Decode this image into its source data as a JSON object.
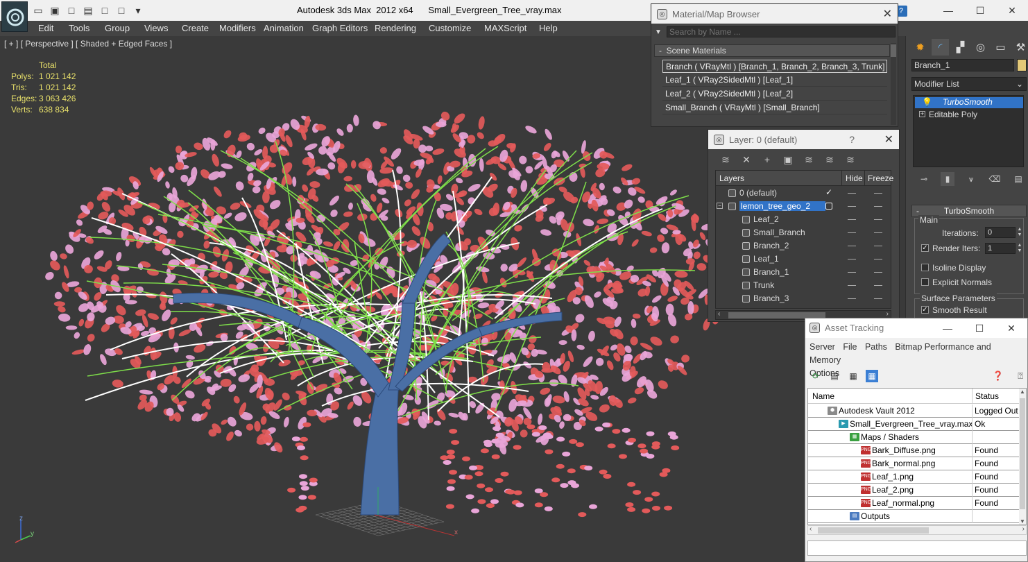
{
  "titlebar": {
    "title": "Autodesk 3ds Max  2012 x64      Small_Evergreen_Tree_vray.max",
    "logo_icon": "app-logo-icon",
    "quick_access_icons": [
      "open-icon",
      "save-icon",
      "new-icon",
      "hold-icon",
      "window-icon",
      "undo-icon",
      "dropdown-icon"
    ],
    "help_label": "?",
    "minimize": "—",
    "maximize": "☐",
    "close": "✕"
  },
  "menu": {
    "items": [
      "Edit",
      "Tools",
      "Group",
      "Views",
      "Create",
      "Modifiers",
      "Animation",
      "Graph Editors",
      "Rendering",
      "Customize",
      "MAXScript",
      "Help"
    ]
  },
  "viewport": {
    "label": "[ + ] [ Perspective ] [ Shaded + Edged Faces ]",
    "stats": {
      "total_label": "Total",
      "rows": [
        {
          "label": "Polys:",
          "value": "1 021 142"
        },
        {
          "label": "Tris:",
          "value": "1 021 142"
        },
        {
          "label": "Edges:",
          "value": "3 063 426"
        },
        {
          "label": "Verts:",
          "value": "638 834"
        }
      ]
    },
    "axis_labels": {
      "z": "z",
      "y": "y",
      "x": "x"
    },
    "colors": {
      "leaf_red": "#e35a5a",
      "leaf_pink": "#e9a5d8",
      "branch_white": "#ffffff",
      "twig_green": "#7fe04a",
      "trunk_blue": "#4a6fa5"
    }
  },
  "material_browser": {
    "title": "Material/Map Browser",
    "search_placeholder": "Search by Name ...",
    "section": "Scene Materials",
    "section_toggle": "-",
    "materials": [
      "Branch  ( VRayMtl )  [Branch_1, Branch_2, Branch_3, Trunk]",
      "Leaf_1  ( VRay2SidedMtl )  [Leaf_1]",
      "Leaf_2  ( VRay2SidedMtl )  [Leaf_2]",
      "Small_Branch  ( VRayMtl )  [Small_Branch]"
    ]
  },
  "layer_dialog": {
    "title": "Layer: 0 (default)",
    "help": "?",
    "columns": {
      "layers": "Layers",
      "hide": "Hide",
      "freeze": "Freeze"
    },
    "rows": [
      {
        "name": "0 (default)",
        "indent": 0
      },
      {
        "name": "lemon_tree_geo_2",
        "indent": 0
      },
      {
        "name": "Leaf_2",
        "indent": 1
      },
      {
        "name": "Small_Branch",
        "indent": 1
      },
      {
        "name": "Branch_2",
        "indent": 1
      },
      {
        "name": "Leaf_1",
        "indent": 1
      },
      {
        "name": "Branch_1",
        "indent": 1
      },
      {
        "name": "Trunk",
        "indent": 1
      },
      {
        "name": "Branch_3",
        "indent": 1
      }
    ]
  },
  "command_panel": {
    "object_name": "Branch_1",
    "object_color": "#e3c878",
    "modifier_list": "Modifier List",
    "stack": [
      "TurboSmooth",
      "Editable Poly"
    ],
    "rollout_title": "TurboSmooth",
    "main_group": "Main",
    "iterations_label": "Iterations:",
    "iterations_value": "0",
    "render_iters_label": "Render Iters:",
    "render_iters_value": "1",
    "isoline_label": "Isoline Display",
    "explicit_normals_label": "Explicit Normals",
    "surface_group": "Surface Parameters",
    "smooth_result_label": "Smooth Result",
    "rollout_toggle": "-"
  },
  "asset_tracking": {
    "title": "Asset Tracking",
    "menu": [
      "Server",
      "File",
      "Paths",
      "Bitmap Performance and Memory",
      "Options"
    ],
    "columns": {
      "name": "Name",
      "status": "Status"
    },
    "rows": [
      {
        "name": "Autodesk Vault 2012",
        "status": "Logged Out",
        "icon": "vault-icon"
      },
      {
        "name": "Small_Evergreen_Tree_vray.max",
        "status": "Ok",
        "icon": "max-file-icon"
      },
      {
        "name": "Maps / Shaders",
        "status": "",
        "icon": "maps-icon"
      },
      {
        "name": "Bark_Diffuse.png",
        "status": "Found",
        "icon": "png-icon"
      },
      {
        "name": "Bark_normal.png",
        "status": "Found",
        "icon": "png-icon"
      },
      {
        "name": "Leaf_1.png",
        "status": "Found",
        "icon": "png-icon"
      },
      {
        "name": "Leaf_2.png",
        "status": "Found",
        "icon": "png-icon"
      },
      {
        "name": "Leaf_normal.png",
        "status": "Found",
        "icon": "png-icon"
      },
      {
        "name": "Outputs",
        "status": "",
        "icon": "outputs-icon"
      }
    ]
  }
}
